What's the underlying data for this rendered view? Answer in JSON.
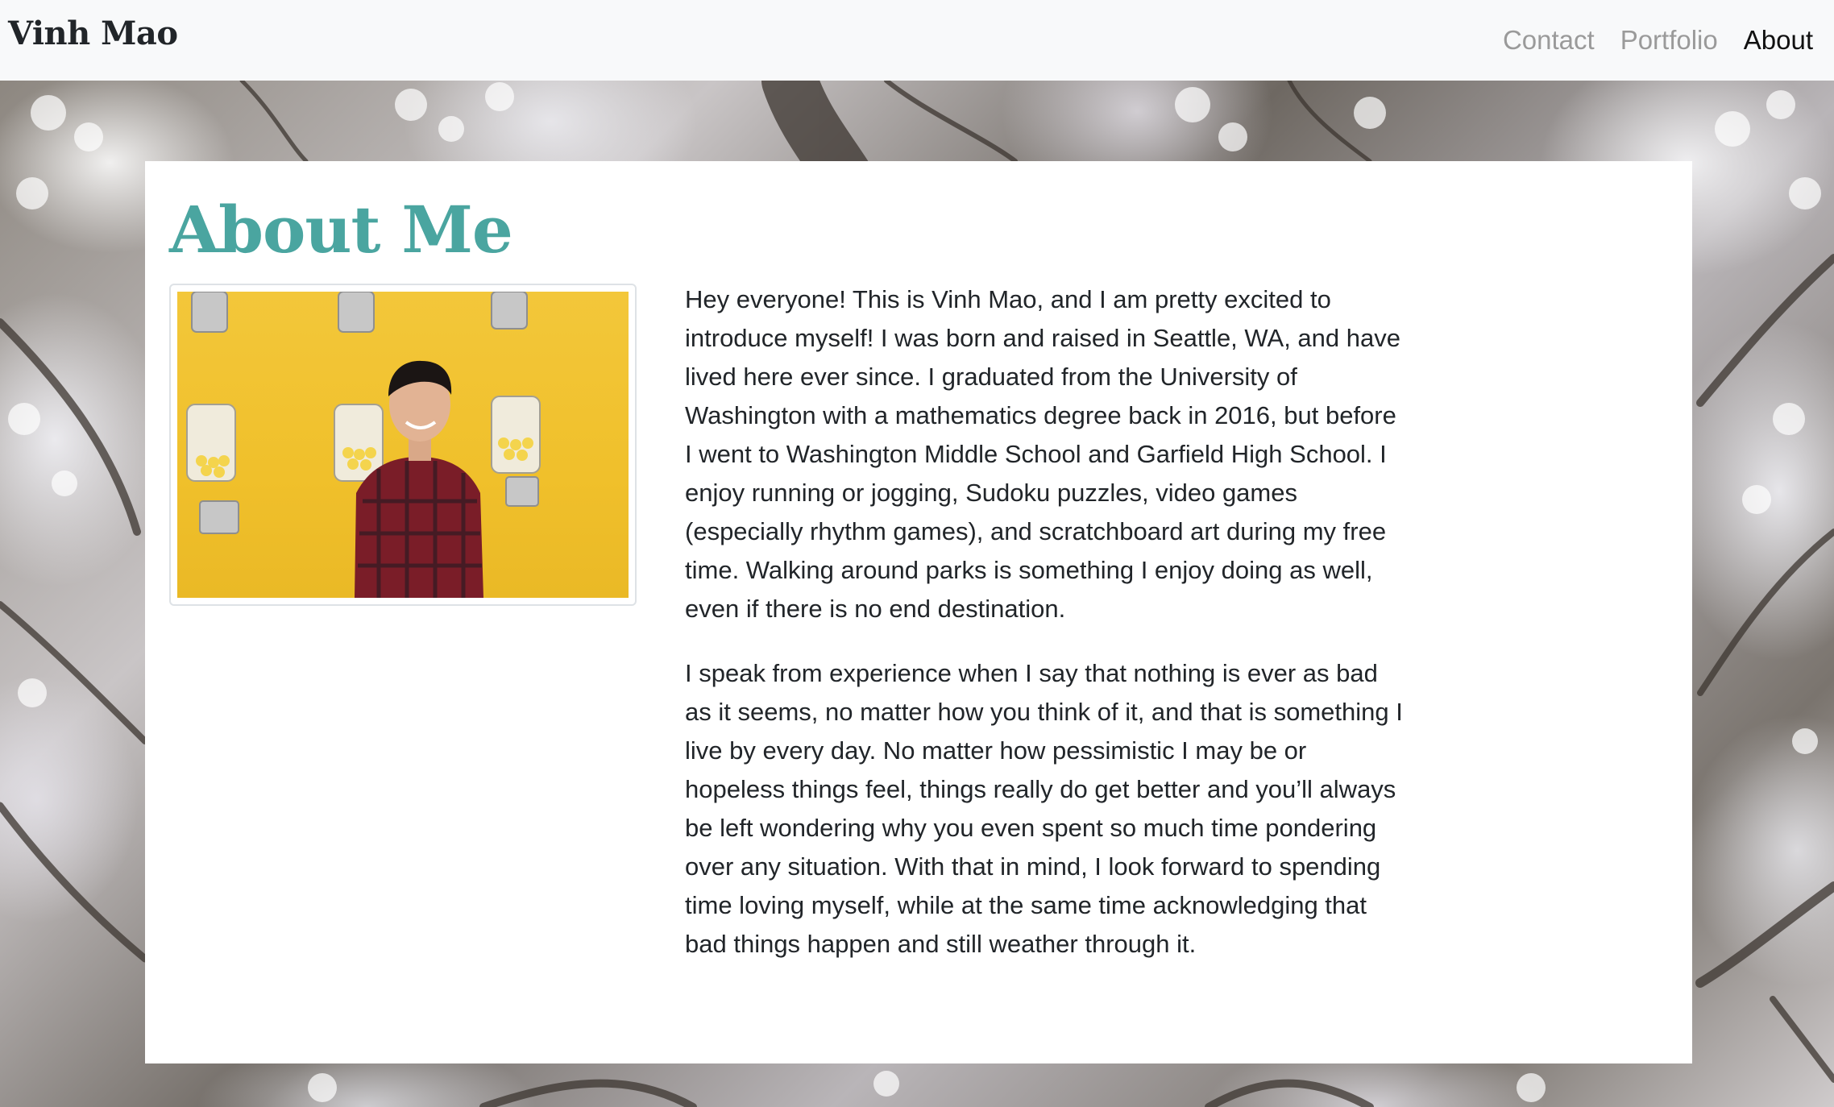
{
  "navbar": {
    "brand": "Vinh Mao",
    "links": [
      {
        "label": "Contact",
        "active": false
      },
      {
        "label": "Portfolio",
        "active": false
      },
      {
        "label": "About",
        "active": true
      }
    ]
  },
  "main": {
    "title": "About Me",
    "photo_icon": "portrait-photo",
    "paragraphs": [
      "Hey everyone! This is Vinh Mao, and I am pretty excited to introduce myself! I was born and raised in Seattle, WA, and have lived here ever since. I graduated from the University of Washington with a mathematics degree back in 2016, but before I went to Washington Middle School and Garfield High School. I enjoy running or jogging, Sudoku puzzles, video games (especially rhythm games), and scratchboard art during my free time. Walking around parks is something I enjoy doing as well, even if there is no end destination.",
      "I speak from experience when I say that nothing is ever as bad as it seems, no matter how you think of it, and that is something I live by every day. No matter how pessimistic I may be or hopeless things feel, things really do get better and you’ll always be left wondering why you even spent so much time pondering over any situation. With that in mind, I look forward to spending time loving myself, while at the same time acknowledging that bad things happen and still weather through it."
    ]
  },
  "colors": {
    "navbar_bg": "#f8f9fa",
    "title_accent": "#4aa5a0",
    "nav_inactive": "#9a9a9a",
    "nav_active": "#111111",
    "body_text": "#212529"
  }
}
